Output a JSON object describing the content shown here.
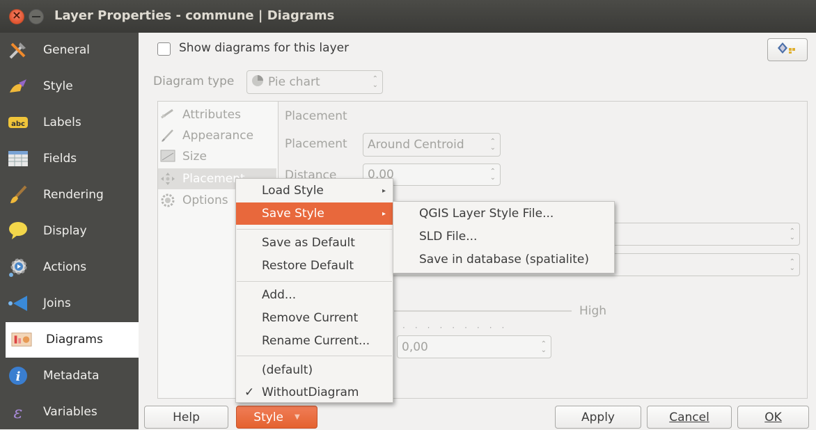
{
  "window": {
    "title": "Layer Properties - commune | Diagrams"
  },
  "sidebar": {
    "items": [
      {
        "label": "General",
        "icon": "tools-icon"
      },
      {
        "label": "Style",
        "icon": "paintbrush-icon"
      },
      {
        "label": "Labels",
        "icon": "abc-label-icon"
      },
      {
        "label": "Fields",
        "icon": "table-icon"
      },
      {
        "label": "Rendering",
        "icon": "brush-icon"
      },
      {
        "label": "Display",
        "icon": "speech-bubble-icon"
      },
      {
        "label": "Actions",
        "icon": "gear-icon"
      },
      {
        "label": "Joins",
        "icon": "join-icon"
      },
      {
        "label": "Diagrams",
        "icon": "diagram-icon",
        "selected": true
      },
      {
        "label": "Metadata",
        "icon": "info-icon"
      },
      {
        "label": "Variables",
        "icon": "epsilon-icon"
      }
    ]
  },
  "main": {
    "show_diagrams_label": "Show diagrams for this layer",
    "show_diagrams_checked": false,
    "diagram_type_label": "Diagram type",
    "diagram_type_value": "Pie chart",
    "tabs": [
      {
        "label": "Attributes"
      },
      {
        "label": "Appearance"
      },
      {
        "label": "Size"
      },
      {
        "label": "Placement",
        "selected": true
      },
      {
        "label": "Options"
      }
    ],
    "placement_section_title": "Placement",
    "placement_label": "Placement",
    "placement_value": "Around Centroid",
    "distance_label": "Distance",
    "distance_value": "0,00",
    "priority_high_label": "High",
    "zindex_value": "0,00"
  },
  "style_menu": {
    "items": [
      {
        "label": "Load Style",
        "submenu": true
      },
      {
        "label": "Save Style",
        "submenu": true,
        "highlighted": true
      },
      {
        "label": "Save as Default"
      },
      {
        "label": "Restore Default"
      },
      {
        "label": "Add..."
      },
      {
        "label": "Remove Current"
      },
      {
        "label": "Rename Current..."
      },
      {
        "label": "(default)"
      },
      {
        "label": "WithoutDiagram",
        "checked": true
      }
    ]
  },
  "save_style_submenu": {
    "items": [
      {
        "label": "QGIS Layer Style File..."
      },
      {
        "label": "SLD File..."
      },
      {
        "label": "Save in database (spatialite)"
      }
    ]
  },
  "buttons": {
    "help": "Help",
    "style": "Style",
    "apply": "Apply",
    "cancel": "Cancel",
    "ok": "OK"
  },
  "colors": {
    "accent": "#e8683c",
    "sidebar_bg": "#4a4a47",
    "titlebar_bg": "#3f3f3c"
  }
}
